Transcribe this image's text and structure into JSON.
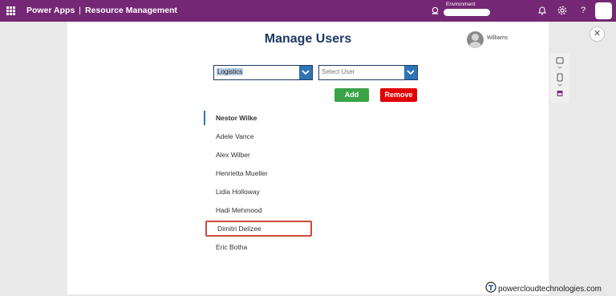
{
  "header": {
    "app_name": "Power Apps",
    "separator": "|",
    "app_title": "Resource Management",
    "environment_label": "Environment",
    "icons": [
      "waffle-icon",
      "environment-icon",
      "notification-icon",
      "settings-icon",
      "help-icon",
      "account-avatar"
    ]
  },
  "page": {
    "title": "Manage Users",
    "current_user": "Williams"
  },
  "department_dropdown": {
    "value": "Logistics"
  },
  "user_dropdown": {
    "placeholder": "Select User"
  },
  "buttons": {
    "add": "Add",
    "remove": "Remove"
  },
  "users": [
    {
      "name": "Nestor Wilke"
    },
    {
      "name": "Adele Vance"
    },
    {
      "name": "Alex Wilber"
    },
    {
      "name": "Henrietta Mueller"
    },
    {
      "name": "Lidia Holloway"
    },
    {
      "name": "Hadi Mehmood"
    },
    {
      "name": "Dimitri Delizee"
    },
    {
      "name": "Eric Botha"
    }
  ],
  "selected_index": 0,
  "highlighted_index": 6,
  "colors": {
    "topbar": "#742774",
    "title": "#1f3864",
    "accent": "#2e75b6",
    "add": "#3aa346",
    "remove": "#e00000",
    "highlight_border": "#cc4a3c"
  },
  "watermark": "powercloudtechnologies.com"
}
